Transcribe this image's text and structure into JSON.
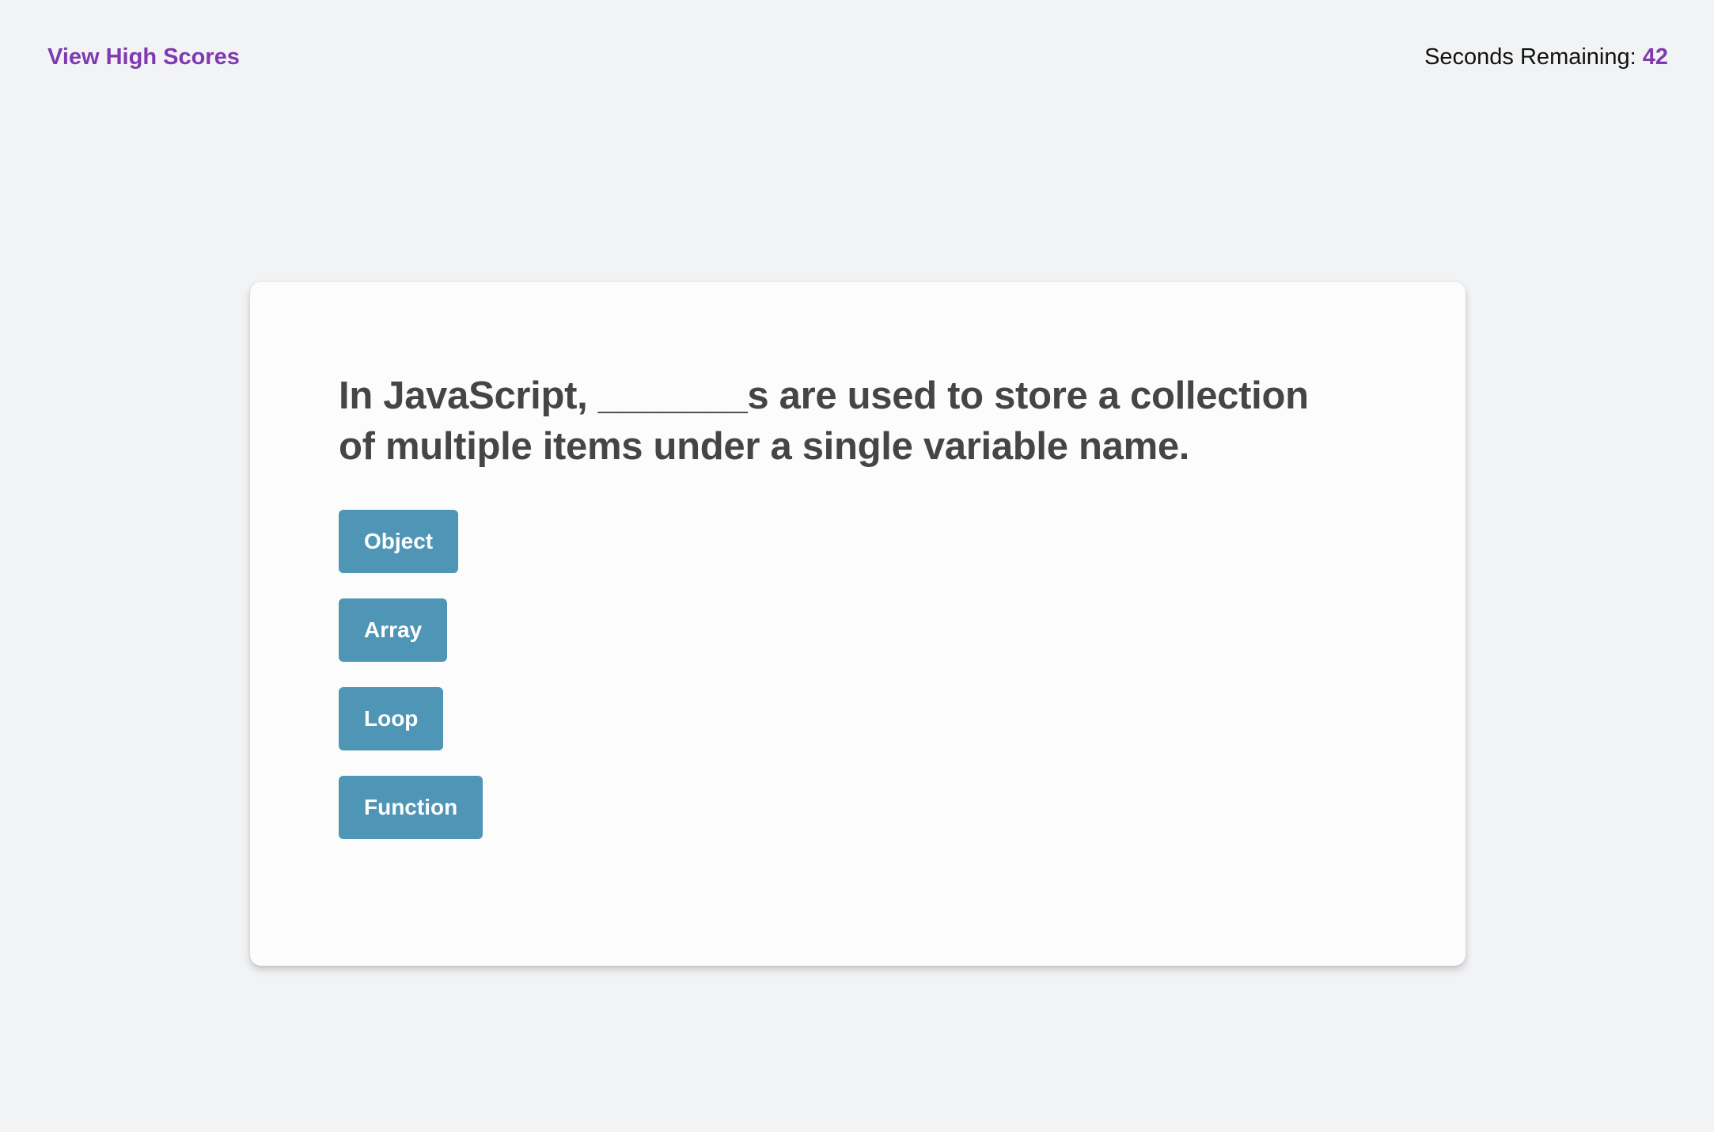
{
  "header": {
    "high_scores_link": "View High Scores",
    "timer_label": "Seconds Remaining: ",
    "timer_value": "42"
  },
  "quiz": {
    "question": "In JavaScript, _______s are used to store a collection of multiple items under a single variable name.",
    "choices": [
      "Object",
      "Array",
      "Loop",
      "Function"
    ]
  },
  "colors": {
    "accent": "#7f3ab0",
    "button": "#4f95b6",
    "background": "#f2f3f5",
    "card": "#fbfcfb",
    "question_text": "#454545"
  }
}
